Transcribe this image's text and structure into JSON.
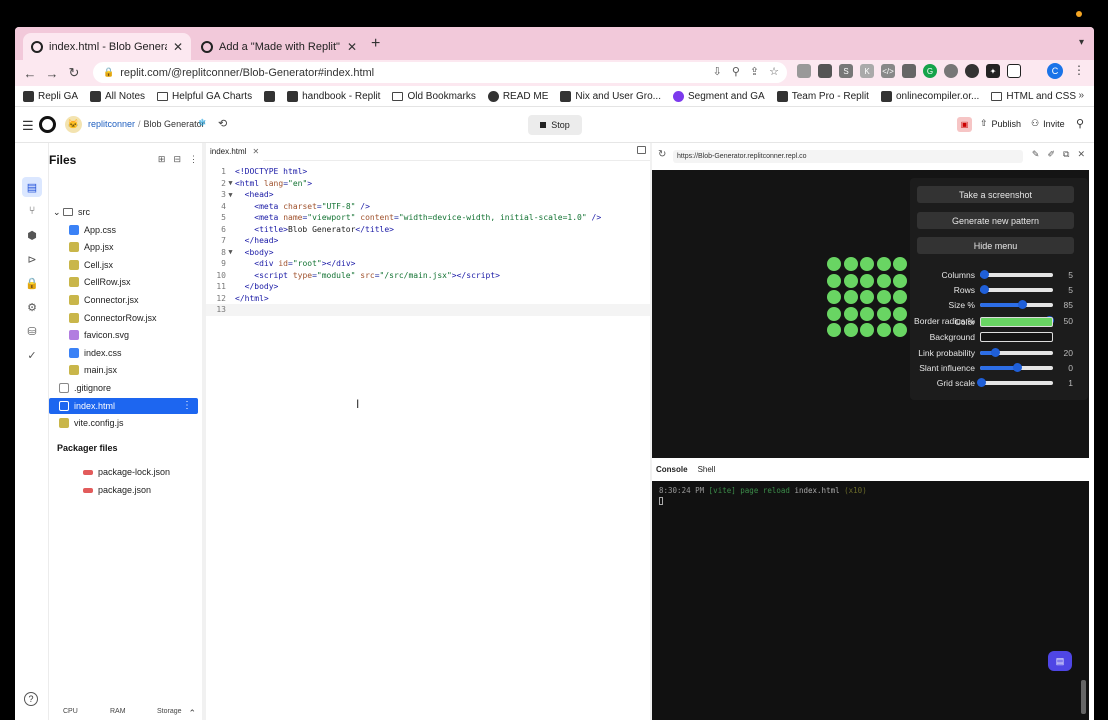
{
  "browser": {
    "tabs": [
      {
        "title": "index.html - Blob Generator - R",
        "active": true
      },
      {
        "title": "Add a \"Made with Replit\" badg",
        "active": false
      }
    ],
    "new_tab": "+",
    "url": "replit.com/@replitconner/Blob-Generator#index.html",
    "profile_initial": "C",
    "bookmarks": [
      "Repli GA",
      "All Notes",
      "Helpful GA Charts",
      "",
      "handbook - Replit",
      "Old Bookmarks",
      "READ ME",
      "Nix and User Gro...",
      "Segment and GA",
      "Team Pro - Replit",
      "onlinecompiler.or...",
      "HTML and CSS"
    ]
  },
  "replit": {
    "user": "replitconner",
    "separator": "/",
    "repl_name": "Blob Generator",
    "stop_label": "Stop",
    "publish_label": "Publish",
    "invite_label": "Invite"
  },
  "files": {
    "title": "Files",
    "tree": [
      {
        "name": "src",
        "type": "folder",
        "indent": 0
      },
      {
        "name": "App.css",
        "type": "css",
        "indent": 1
      },
      {
        "name": "App.jsx",
        "type": "jsx",
        "indent": 1
      },
      {
        "name": "Cell.jsx",
        "type": "jsx",
        "indent": 1
      },
      {
        "name": "CellRow.jsx",
        "type": "jsx",
        "indent": 1
      },
      {
        "name": "Connector.jsx",
        "type": "jsx",
        "indent": 1
      },
      {
        "name": "ConnectorRow.jsx",
        "type": "jsx",
        "indent": 1
      },
      {
        "name": "favicon.svg",
        "type": "svg",
        "indent": 1
      },
      {
        "name": "index.css",
        "type": "css",
        "indent": 1
      },
      {
        "name": "main.jsx",
        "type": "jsx",
        "indent": 1
      },
      {
        "name": ".gitignore",
        "type": "git",
        "indent": 0
      },
      {
        "name": "index.html",
        "type": "html",
        "indent": 0,
        "selected": true
      },
      {
        "name": "vite.config.js",
        "type": "jsx",
        "indent": 0
      }
    ],
    "packager_title": "Packager files",
    "packager": [
      "package-lock.json",
      "package.json"
    ],
    "resources": [
      {
        "label": "CPU",
        "level": 0.05
      },
      {
        "label": "RAM",
        "level": 0.06
      },
      {
        "label": "Storage",
        "level": 0.05
      }
    ]
  },
  "editor": {
    "tab": "index.html",
    "lines": [
      {
        "n": "1",
        "fold": "",
        "html": "<span class='tg'>&lt;!DOCTYPE html&gt;</span>"
      },
      {
        "n": "2",
        "fold": "▼",
        "html": "<span class='tg'>&lt;html</span> <span class='at'>lang</span>=<span class='st'>\"en\"</span><span class='tg'>&gt;</span>"
      },
      {
        "n": "3",
        "fold": "▼",
        "html": "  <span class='tg'>&lt;head&gt;</span>"
      },
      {
        "n": "4",
        "fold": "",
        "html": "    <span class='tg'>&lt;meta</span> <span class='at'>charset</span>=<span class='st'>\"UTF-8\"</span> <span class='tg'>/&gt;</span>"
      },
      {
        "n": "5",
        "fold": "",
        "html": "    <span class='tg'>&lt;meta</span> <span class='at'>name</span>=<span class='st'>\"viewport\"</span> <span class='at'>content</span>=<span class='st'>\"width=device-width, initial-scale=1.0\"</span> <span class='tg'>/&gt;</span>"
      },
      {
        "n": "6",
        "fold": "",
        "html": "    <span class='tg'>&lt;title&gt;</span><span class='pl'>Blob Generator</span><span class='tg'>&lt;/title&gt;</span>"
      },
      {
        "n": "7",
        "fold": "",
        "html": "  <span class='tg'>&lt;/head&gt;</span>"
      },
      {
        "n": "8",
        "fold": "▼",
        "html": "  <span class='tg'>&lt;body&gt;</span>"
      },
      {
        "n": "9",
        "fold": "",
        "html": "    <span class='tg'>&lt;div</span> <span class='at'>id</span>=<span class='st'>\"root\"</span><span class='tg'>&gt;&lt;/div&gt;</span>"
      },
      {
        "n": "10",
        "fold": "",
        "html": "    <span class='tg'>&lt;script</span> <span class='at'>type</span>=<span class='st'>\"module\"</span> <span class='at'>src</span>=<span class='st'>\"/src/main.jsx\"</span><span class='tg'>&gt;&lt;/script&gt;</span>"
      },
      {
        "n": "11",
        "fold": "",
        "html": "  <span class='tg'>&lt;/body&gt;</span>"
      },
      {
        "n": "12",
        "fold": "",
        "html": "<span class='tg'>&lt;/html&gt;</span>"
      },
      {
        "n": "13",
        "fold": "",
        "html": ""
      }
    ]
  },
  "webview": {
    "url": "https://Blob-Generator.replitconner.repl.co",
    "menu": {
      "buttons": [
        "Take a screenshot",
        "Generate new pattern",
        "Hide menu"
      ],
      "sliders": [
        {
          "label": "Columns",
          "value": "5",
          "level": 0.05
        },
        {
          "label": "Rows",
          "value": "5",
          "level": 0.05
        },
        {
          "label": "Size %",
          "value": "85",
          "level": 0.57
        },
        {
          "label": "Border radius %",
          "value": "50",
          "level": 0.95
        }
      ],
      "color_label": "Color",
      "color_value": "#69d563",
      "background_label": "Background",
      "background_value": "#141414",
      "sliders2": [
        {
          "label": "Link probability",
          "value": "20",
          "level": 0.2
        },
        {
          "label": "Slant influence",
          "value": "0",
          "level": 0.5
        },
        {
          "label": "Grid scale",
          "value": "1",
          "level": 0.02
        }
      ]
    },
    "blobs": {
      "cols": 5,
      "rows": 5,
      "color": "#69d563"
    }
  },
  "console": {
    "tabs": [
      "Console",
      "Shell"
    ],
    "log": {
      "time": "8:30:24 PM",
      "tag": "[vite]",
      "msg": "page reload",
      "file": "index.html",
      "count": "(x10)"
    }
  }
}
